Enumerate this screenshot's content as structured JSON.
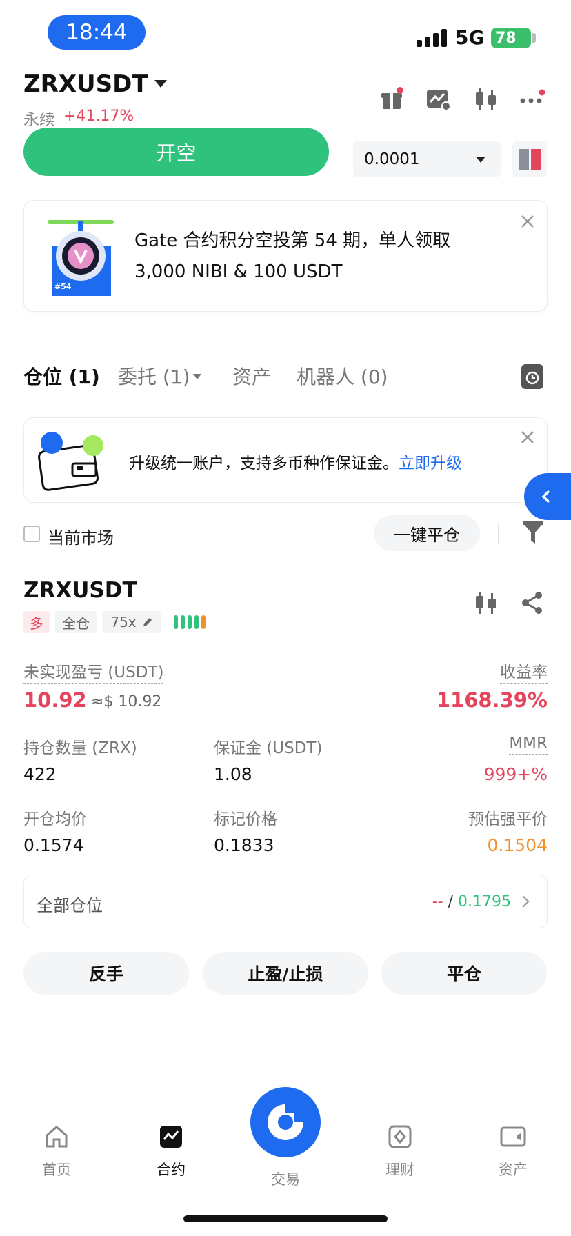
{
  "status_bar": {
    "time": "18:44",
    "network": "5G",
    "battery": "78"
  },
  "header": {
    "symbol": "ZRXUSDT",
    "contract_type": "永续",
    "change": "+41.17%",
    "icons": [
      "gift-icon",
      "chart-alert-icon",
      "candlestick-icon",
      "more-icon"
    ]
  },
  "order": {
    "open_short_label": "开空",
    "quantity": "0.0001"
  },
  "promo_banner": {
    "badge": "#54",
    "text": "Gate 合约积分空投第 54 期，单人领取 3,000 NIBI & 100 USDT"
  },
  "tabs": [
    {
      "label": "仓位 (1)",
      "active": true
    },
    {
      "label": "委托 (1)",
      "active": false
    },
    {
      "label": "资产",
      "active": false
    },
    {
      "label": "机器人 (0)",
      "active": false
    }
  ],
  "upgrade_card": {
    "text": "升级统一账户，支持多币种作保证金。",
    "link": "立即升级"
  },
  "filters": {
    "current_market": "当前市场",
    "close_all": "一键平仓"
  },
  "position": {
    "symbol": "ZRXUSDT",
    "side_tag": "多",
    "margin_mode": "全仓",
    "leverage": "75x",
    "unrealized_pnl_label": "未实现盈亏 (USDT)",
    "unrealized_pnl": "10.92",
    "unrealized_pnl_usd": "≈$ 10.92",
    "roe_label": "收益率",
    "roe": "1168.39%",
    "size_label": "持仓数量 (ZRX)",
    "size": "422",
    "margin_label": "保证金 (USDT)",
    "margin": "1.08",
    "mmr_label": "MMR",
    "mmr": "999+%",
    "entry_price_label": "开仓均价",
    "entry_price": "0.1574",
    "mark_price_label": "标记价格",
    "mark_price": "0.1833",
    "liq_price_label": "预估强平价",
    "liq_price": "0.1504"
  },
  "all_positions": {
    "label": "全部仓位",
    "value_a": "--",
    "separator": "/",
    "value_b": "0.1795"
  },
  "actions": {
    "reverse": "反手",
    "tp_sl": "止盈/止损",
    "close": "平仓"
  },
  "bottom_nav": [
    {
      "label": "首页",
      "icon": "home-icon",
      "active": false
    },
    {
      "label": "合约",
      "icon": "futures-icon",
      "active": true
    },
    {
      "label": "交易",
      "icon": "gate-logo-icon",
      "active": false
    },
    {
      "label": "理财",
      "icon": "earn-icon",
      "active": false
    },
    {
      "label": "资产",
      "icon": "wallet-icon",
      "active": false
    }
  ],
  "colors": {
    "accent": "#1f6bf0",
    "up": "#2fc27c",
    "down": "#e5455c",
    "warning": "#f0902e"
  }
}
